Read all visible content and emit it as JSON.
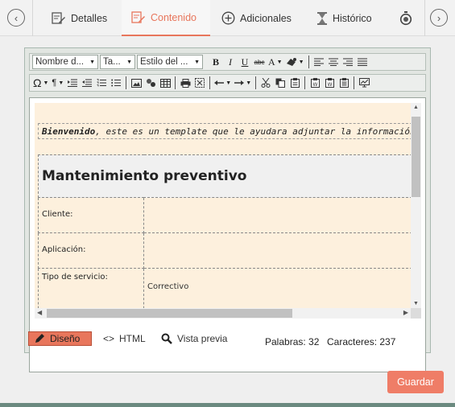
{
  "tabs": [
    {
      "label": "Detalles",
      "icon": "edit-document-icon"
    },
    {
      "label": "Contenido",
      "icon": "edit-document-icon",
      "active": true
    },
    {
      "label": "Adicionales",
      "icon": "plus-circle-icon"
    },
    {
      "label": "Histórico",
      "icon": "hourglass-icon"
    },
    {
      "label": "",
      "icon": "timer-icon"
    }
  ],
  "toolbar": {
    "font_name": "Nombre d...",
    "font_size": "Ta...",
    "font_style": "Estilo del ...",
    "bold": "B",
    "italic": "I",
    "underline": "U",
    "strike": "abc",
    "font_color": "A"
  },
  "document": {
    "intro_bold": "Bienvenido",
    "intro_rest": ", este es un template que le ayudara adjuntar la información básica, para la sol",
    "title": "Mantenimiento preventivo",
    "rows": [
      {
        "label": "Cliente:",
        "value": ""
      },
      {
        "label": "Aplicación:",
        "value": ""
      },
      {
        "label": "Tipo de servicio:",
        "value": "Correctivo"
      }
    ]
  },
  "modes": {
    "design": "Diseño",
    "html": "HTML",
    "preview": "Vista previa"
  },
  "stats": {
    "words_label": "Palabras:",
    "words": "32",
    "chars_label": "Caracteres:",
    "chars": "237"
  },
  "save_label": "Guardar",
  "colors": {
    "accent": "#e8765c",
    "save": "#ef7d67",
    "content_bg": "#fdf0dd"
  }
}
